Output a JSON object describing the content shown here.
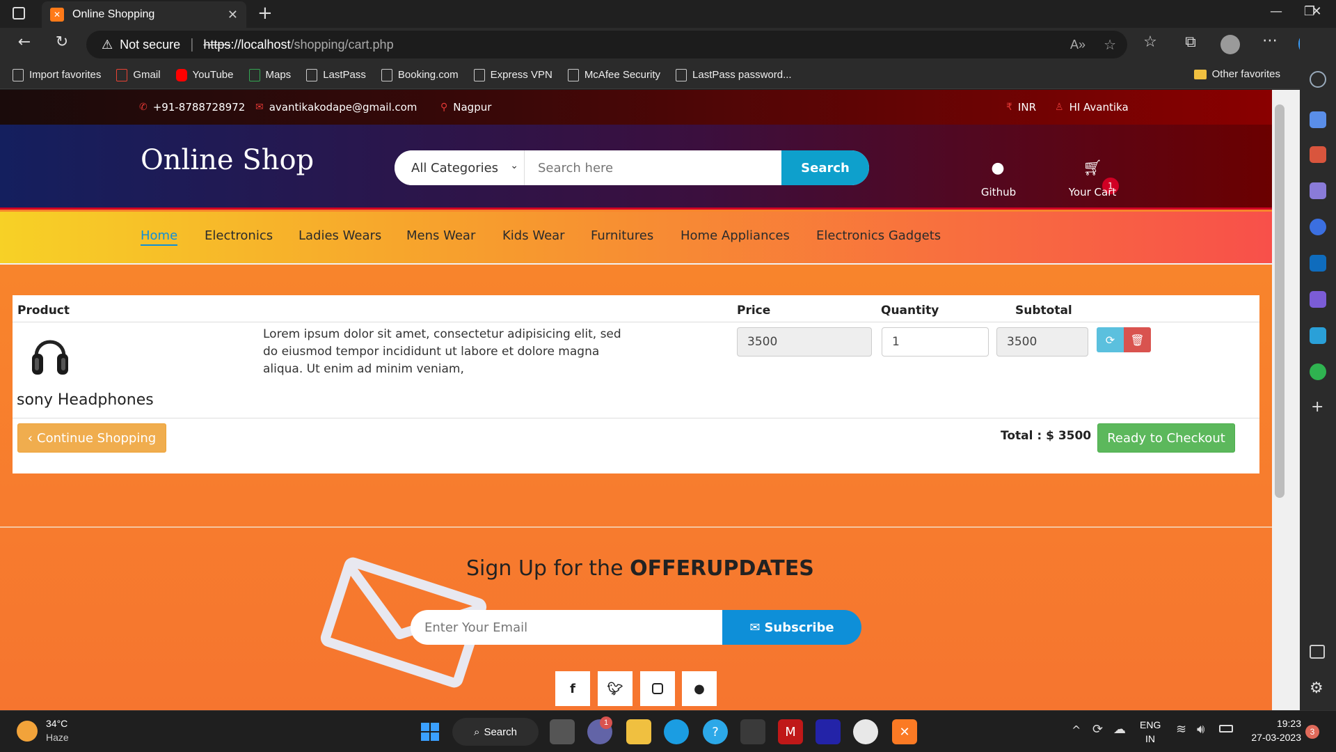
{
  "browser": {
    "tab_title": "Online Shopping",
    "tab_close": "✕",
    "new_tab": "+",
    "security_label": "Not secure",
    "url_scheme": "https",
    "url_host": "://localhost",
    "url_path": "/shopping/cart.php",
    "bookmarks": [
      "Import favorites",
      "Gmail",
      "YouTube",
      "Maps",
      "LastPass",
      "Booking.com",
      "Express VPN",
      "McAfee Security",
      "LastPass password..."
    ],
    "other_favorites": "Other favorites"
  },
  "topbar": {
    "phone": "+91-8788728972",
    "email": "avantikakodape@gmail.com",
    "location": "Nagpur",
    "currency": "INR",
    "user": "HI Avantika"
  },
  "header": {
    "logo": "Online Shop",
    "category_selected": "All Categories",
    "search_placeholder": "Search here",
    "search_button": "Search",
    "github_label": "Github",
    "cart_label": "Your Cart",
    "cart_count": "1"
  },
  "nav": {
    "items": [
      "Home",
      "Electronics",
      "Ladies Wears",
      "Mens Wear",
      "Kids Wear",
      "Furnitures",
      "Home Appliances",
      "Electronics Gadgets"
    ]
  },
  "cart": {
    "headers": {
      "product": "Product",
      "price": "Price",
      "quantity": "Quantity",
      "subtotal": "Subtotal"
    },
    "item": {
      "name": "sony Headphones",
      "description": "Lorem ipsum dolor sit amet, consectetur adipisicing elit, sed do eiusmod tempor incididunt ut labore et dolore magna aliqua. Ut enim ad minim veniam,",
      "price": "3500",
      "quantity": "1",
      "subtotal": "3500"
    },
    "continue_label": "Continue Shopping",
    "total_label": "Total : $ 3500",
    "checkout_label": "Ready to Checkout"
  },
  "newsletter": {
    "title_prefix": "Sign Up for the ",
    "title_bold": "OFFERUPDATES",
    "email_placeholder": "Enter Your Email",
    "subscribe_label": "Subscribe"
  },
  "social": [
    "f",
    "t",
    "ig",
    "gh"
  ],
  "taskbar": {
    "temperature": "34°C",
    "weather": "Haze",
    "search_label": "Search",
    "lang_top": "ENG",
    "lang_bottom": "IN",
    "time": "19:23",
    "date": "27-03-2023",
    "notifications": "3",
    "teams_badge": "1"
  },
  "colors": {
    "accent_blue": "#0e8fd8",
    "brand_red": "#d10024",
    "success_green": "#5cb85c",
    "warning_orange": "#f0ad4e"
  }
}
